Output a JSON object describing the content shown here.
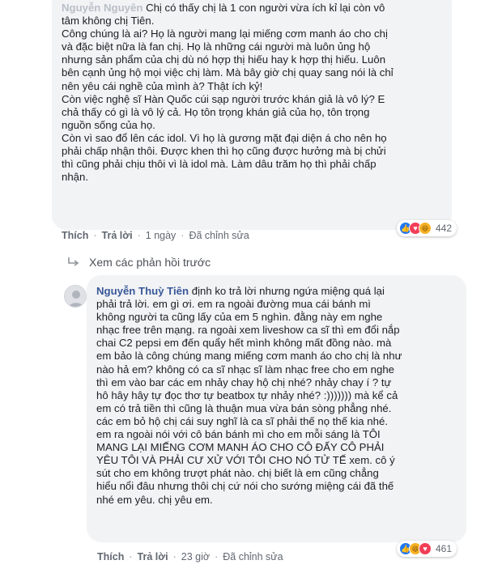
{
  "comment1": {
    "author": "Nguyễn Nguyên",
    "text_first": "Chị có thấy chị là 1 con người vừa ích kỉ lại còn vô\ntâm không chị Tiên.\nCông chúng là ai? Họ là người mang lại miếng cơm manh áo cho chị\nvà đặc biệt nữa là fan chị. Họ là những cái người mà luôn ủng hộ\nnhưng sản phẩm của chị dù nó hợp thị hiếu hay k hợp thị hiếu. Luôn\nbên cạnh ủng hộ mọi việc chị làm. Mà bây giờ chị quay sang nói là chỉ\nnên yêu cái nghề của mình à? Thật ích kỷ!\nCòn việc nghệ sĩ Hàn Quốc cúi sạp người trước khán giả là vô lý? E\nchả thấy có gì là vô lý cả. Họ tôn trọng khán giả của họ, tôn trọng\nnguồn sống của họ.\nCòn vì sao đổ lên các idol. Vì họ là gương mặt đại diện á cho nên họ\nphải chấp nhận thôi. Được khen thì họ cũng được hưởng mà bị chửi\nthì cũng phải chịu thôi vì là idol mà. Làm dâu trăm họ thì phải chấp\nnhận.",
    "actions": {
      "like": "Thích",
      "reply": "Trả lời",
      "time": "1 ngày",
      "edited": "Đã chỉnh sửa"
    },
    "reaction_count": "442",
    "reaction_icons": [
      "like-icon",
      "love-icon",
      "haha-icon"
    ]
  },
  "view_previous": "Xem các phản hồi trước",
  "comment2": {
    "author": "Nguyễn Thuỳ Tiên",
    "text": "định ko trả lời nhưng ngứa miệng quá lại\nphải trả lời. em gì ơi. em ra ngoài đường mua cái bánh mì\nkhông người ta cũng lấy của em 5 nghìn. đằng này em nghe\nnhạc free trên mạng. ra ngoài xem liveshow ca sĩ thì em đổi nắp\nchai C2 pepsi em đến quẩy hết mình không mất đồng nào. mà\nem bảo là công chúng mang miếng cơm manh áo cho chị là như\nnào hả em? không có ca sĩ nhạc sĩ làm nhạc free cho em nghe\nthì em vào bar các em nhảy chay hộ chị nhé? nhảy chay í ? tự\nhô hây hây tự đọc thơ tự beatbox tự nhảy nhé? :))))))) mà kể cả\nem có trả tiền thì cũng là thuận mua vừa bán sòng phẳng nhé.\ncác em bỏ hộ chị cái suy nghĩ là ca sĩ phải thế nọ thế kia nhé.\nem ra ngoài nói với cô bán bánh mì cho em mỗi sáng là TÔI\nMANG LẠI MIẾNG CƠM MANH ÁO CHO CÔ ĐẤY CÔ PHẢI\nYÊU TÔI VÀ PHẢI CƯ XỬ VỚI TÔI CHO NÓ TỬ TẾ xem. cô ý\nsút cho em không trượt phát nào. chị biết là em cũng chẳng\nhiểu nổi đâu nhưng thôi chị cứ nói cho sướng miệng cái đã thế\nnhé em yêu. chị yêu em.",
    "actions": {
      "like": "Thích",
      "reply": "Trả lời",
      "time": "23 giờ",
      "edited": "Đã chỉnh sửa"
    },
    "reaction_count": "461",
    "reaction_icons": [
      "like-icon",
      "haha-icon",
      "love-icon"
    ]
  }
}
